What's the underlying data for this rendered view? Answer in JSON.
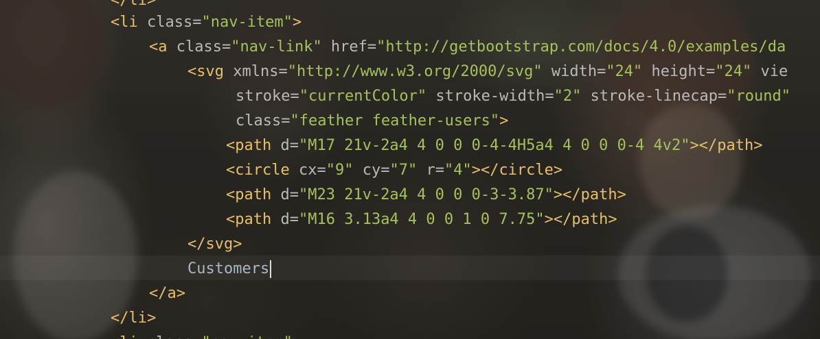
{
  "editor": {
    "background": "anime-wallpaper",
    "colors": {
      "tag": "#e8bf6a",
      "attribute": "#bababa",
      "string": "#a5c25c",
      "text": "#a9b7c6"
    },
    "lines": [
      {
        "id": "l0",
        "tokens": [
          {
            "t": "tag",
            "v": "</li>"
          }
        ]
      },
      {
        "id": "l1",
        "tokens": [
          {
            "t": "tag",
            "v": "<li "
          },
          {
            "t": "attr",
            "v": "class="
          },
          {
            "t": "str",
            "v": "\"nav-item\""
          },
          {
            "t": "tag",
            "v": ">"
          }
        ]
      },
      {
        "id": "l2",
        "tokens": [
          {
            "t": "tag",
            "v": "<a "
          },
          {
            "t": "attr",
            "v": "class="
          },
          {
            "t": "str",
            "v": "\"nav-link\""
          },
          {
            "t": "attr",
            "v": " href="
          },
          {
            "t": "str",
            "v": "\"http://getbootstrap.com/docs/4.0/examples/da"
          }
        ]
      },
      {
        "id": "l3",
        "tokens": [
          {
            "t": "tag",
            "v": "<svg "
          },
          {
            "t": "attr",
            "v": "xmlns="
          },
          {
            "t": "str",
            "v": "\"http://www.w3.org/2000/svg\""
          },
          {
            "t": "attr",
            "v": " width="
          },
          {
            "t": "str",
            "v": "\"24\""
          },
          {
            "t": "attr",
            "v": " height="
          },
          {
            "t": "str",
            "v": "\"24\""
          },
          {
            "t": "attr",
            "v": " vie"
          }
        ]
      },
      {
        "id": "l4",
        "tokens": [
          {
            "t": "attr",
            "v": "stroke="
          },
          {
            "t": "str",
            "v": "\"currentColor\""
          },
          {
            "t": "attr",
            "v": " stroke-width="
          },
          {
            "t": "str",
            "v": "\"2\""
          },
          {
            "t": "attr",
            "v": " stroke-linecap="
          },
          {
            "t": "str",
            "v": "\"round\""
          }
        ]
      },
      {
        "id": "l5",
        "tokens": [
          {
            "t": "attr",
            "v": "class="
          },
          {
            "t": "str",
            "v": "\"feather feather-users\""
          },
          {
            "t": "tag",
            "v": ">"
          }
        ]
      },
      {
        "id": "l6",
        "tokens": [
          {
            "t": "tag",
            "v": "<path "
          },
          {
            "t": "attr",
            "v": "d="
          },
          {
            "t": "str",
            "v": "\"M17 21v-2a4 4 0 0 0-4-4H5a4 4 0 0 0-4 4v2\""
          },
          {
            "t": "tag",
            "v": "></path>"
          }
        ]
      },
      {
        "id": "l7",
        "tokens": [
          {
            "t": "tag",
            "v": "<circle "
          },
          {
            "t": "attr",
            "v": "cx="
          },
          {
            "t": "str",
            "v": "\"9\""
          },
          {
            "t": "attr",
            "v": " cy="
          },
          {
            "t": "str",
            "v": "\"7\""
          },
          {
            "t": "attr",
            "v": " r="
          },
          {
            "t": "str",
            "v": "\"4\""
          },
          {
            "t": "tag",
            "v": "></circle>"
          }
        ]
      },
      {
        "id": "l8",
        "tokens": [
          {
            "t": "tag",
            "v": "<path "
          },
          {
            "t": "attr",
            "v": "d="
          },
          {
            "t": "str",
            "v": "\"M23 21v-2a4 4 0 0 0-3-3.87\""
          },
          {
            "t": "tag",
            "v": "></path>"
          }
        ]
      },
      {
        "id": "l9",
        "tokens": [
          {
            "t": "tag",
            "v": "<path "
          },
          {
            "t": "attr",
            "v": "d="
          },
          {
            "t": "str",
            "v": "\"M16 3.13a4 4 0 0 1 0 7.75\""
          },
          {
            "t": "tag",
            "v": "></path>"
          }
        ]
      },
      {
        "id": "l10",
        "tokens": [
          {
            "t": "tag",
            "v": "</svg>"
          }
        ]
      },
      {
        "id": "l11",
        "tokens": [
          {
            "t": "txt",
            "v": "Customers"
          }
        ],
        "caret": true
      },
      {
        "id": "l12",
        "tokens": [
          {
            "t": "tag",
            "v": "</a>"
          }
        ]
      },
      {
        "id": "l13",
        "tokens": [
          {
            "t": "tag",
            "v": "</li>"
          }
        ]
      },
      {
        "id": "l14",
        "tokens": [
          {
            "t": "tag",
            "v": "<li "
          },
          {
            "t": "attr",
            "v": "class="
          },
          {
            "t": "str",
            "v": "\"nav-item\""
          },
          {
            "t": "tag",
            "v": ">"
          }
        ]
      }
    ]
  }
}
